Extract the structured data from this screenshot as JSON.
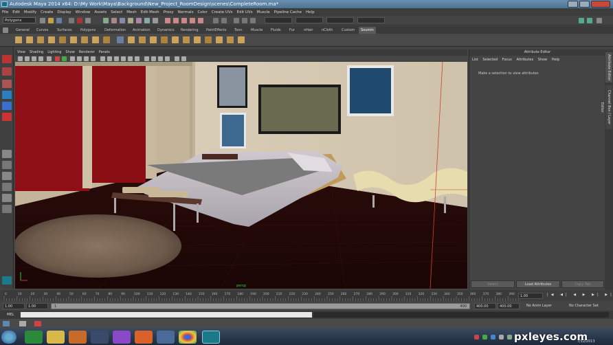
{
  "window": {
    "title": "Autodesk Maya 2014 x64: D:\\My Work\\Maya\\Background\\New_Project_RoomDesign\\scenes\\CompleteRoom.ma*"
  },
  "menubar": [
    "File",
    "Edit",
    "Modify",
    "Create",
    "Display",
    "Window",
    "Assets",
    "Select",
    "Mesh",
    "Edit Mesh",
    "Proxy",
    "Normals",
    "Color",
    "Create UVs",
    "Edit UVs",
    "Muscle",
    "Pipeline Cache",
    "Help"
  ],
  "statusline": {
    "mode_value": "Polygons"
  },
  "shelf_tabs": [
    "General",
    "Curves",
    "Surfaces",
    "Polygons",
    "Deformation",
    "Animation",
    "Dynamics",
    "Rendering",
    "PaintEffects",
    "Toon",
    "Muscle",
    "Fluids",
    "Fur",
    "nHair",
    "nCloth",
    "Custom",
    "Soumin"
  ],
  "shelf_active": "Soumin",
  "viewport_menu": [
    "View",
    "Shading",
    "Lighting",
    "Show",
    "Renderer",
    "Panels"
  ],
  "viewport_label": "persp",
  "attribute_editor": {
    "title": "Attribute Editor",
    "menu": [
      "List",
      "Selected",
      "Focus",
      "Attributes",
      "Show",
      "Help"
    ],
    "message": "Make a selection to view attributes",
    "buttons": [
      "Select",
      "Load Attributes",
      "Copy Tab"
    ]
  },
  "side_tabs": [
    "Attribute Editor",
    "Channel Box / Layer Editor"
  ],
  "timeline": {
    "ticks": [
      "0",
      "10",
      "20",
      "30",
      "40",
      "50",
      "60",
      "70",
      "80",
      "90",
      "100",
      "110",
      "120",
      "130",
      "140",
      "150",
      "160",
      "170",
      "180",
      "190",
      "200",
      "210",
      "220",
      "230",
      "240",
      "250",
      "260",
      "270",
      "280",
      "290",
      "300",
      "310",
      "320",
      "330",
      "340",
      "350",
      "360",
      "370",
      "380",
      "390"
    ],
    "current_frame": "1.00"
  },
  "range": {
    "start": "1.00",
    "start2": "1.00",
    "slider_start": "1",
    "slider_end": "400",
    "end": "400.00",
    "end2": "400.00",
    "anim_layer": "No Anim Layer",
    "char_set": "No Character Set"
  },
  "cmdline": {
    "label": "MEL"
  },
  "watermark": "pxleyes.com",
  "clock": "7/12/2013",
  "colors": {
    "accent": "#4d7393",
    "wall": "#d4c8b2",
    "floor": "#2a0b0a",
    "curtain": "#8e0f15"
  }
}
